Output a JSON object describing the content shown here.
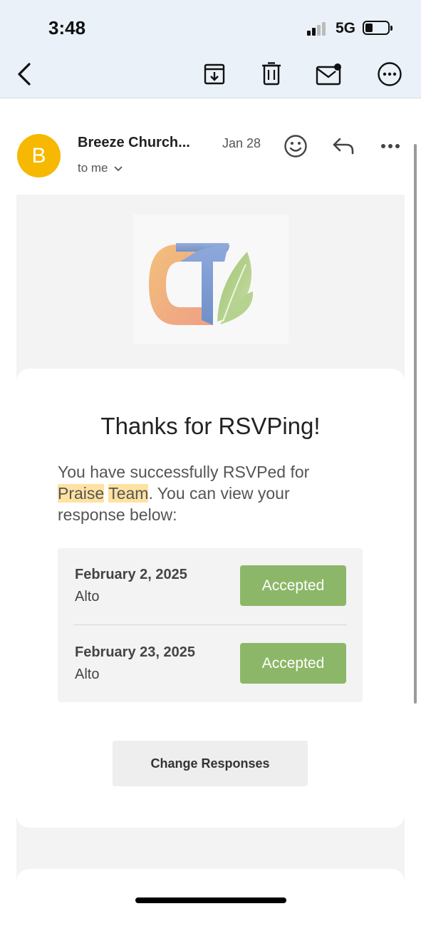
{
  "status_bar": {
    "time": "3:48",
    "network": "5G"
  },
  "toolbar": {
    "back_icon": "chevron-left-icon",
    "archive_icon": "archive-icon",
    "trash_icon": "trash-icon",
    "mark_unread_icon": "mail-unread-icon",
    "more_icon": "more-circle-icon"
  },
  "email": {
    "avatar_letter": "B",
    "avatar_color": "#f6b800",
    "sender": "Breeze Church...",
    "date": "Jan 28",
    "to": "to me",
    "icons": [
      "emoji-icon",
      "reply-icon",
      "more-icon"
    ]
  },
  "content": {
    "title": "Thanks for RSVPing!",
    "message_before": "You have successfully RSVPed for ",
    "event_word1": "Praise",
    "event_word2": "Team",
    "message_after": ". You can view your response below:",
    "responses": [
      {
        "date": "February 2, 2025",
        "role": "Alto",
        "status": "Accepted"
      },
      {
        "date": "February 23, 2025",
        "role": "Alto",
        "status": "Accepted"
      }
    ],
    "change_button": "Change Responses",
    "accent_color": "#8cb768",
    "highlight_color": "#ffe2a2"
  }
}
